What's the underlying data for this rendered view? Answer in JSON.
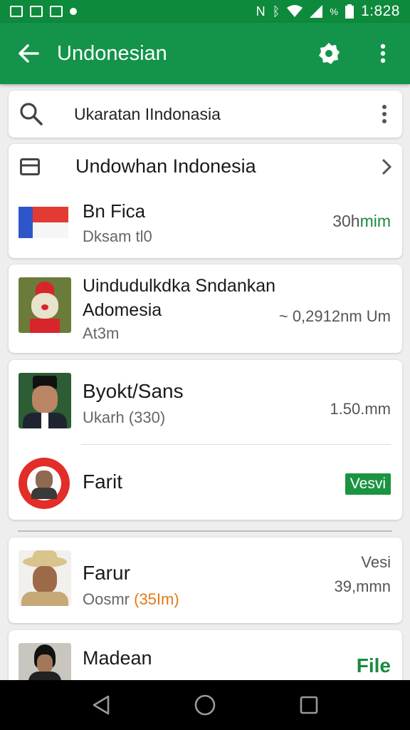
{
  "statusbar": {
    "time": "1:828",
    "battery": "%"
  },
  "appbar": {
    "title": "Undonesian"
  },
  "search": {
    "value": "Ukaratan IIndonasia"
  },
  "section_card": {
    "header": "Undowhan Indonesia",
    "item": {
      "title": "Bn Fica",
      "subtitle": "Dksam tl0",
      "value": "30hmim"
    }
  },
  "items": [
    {
      "title_line1": "Uindudulkdka Sndankan",
      "title_line2": "Adomesia",
      "subtitle": "At3m",
      "value": "~ 0,2912nm Um"
    },
    {
      "title": "Byokt/Sans",
      "subtitle": "Ukarh (330)",
      "value": "1.50.mm"
    },
    {
      "title": "Farit",
      "badge": "Vesvi"
    },
    {
      "title": "Farur",
      "subtitle_prefix": "Oosmr ",
      "subtitle_highlight": "(35Im)",
      "value_line1": "Vesi",
      "value_line2": "39,mmn"
    },
    {
      "title": "Madean",
      "value": "File"
    }
  ],
  "colors": {
    "primary": "#13944a",
    "statusbar": "#0e8a3c",
    "accent_orange": "#e07b16"
  }
}
